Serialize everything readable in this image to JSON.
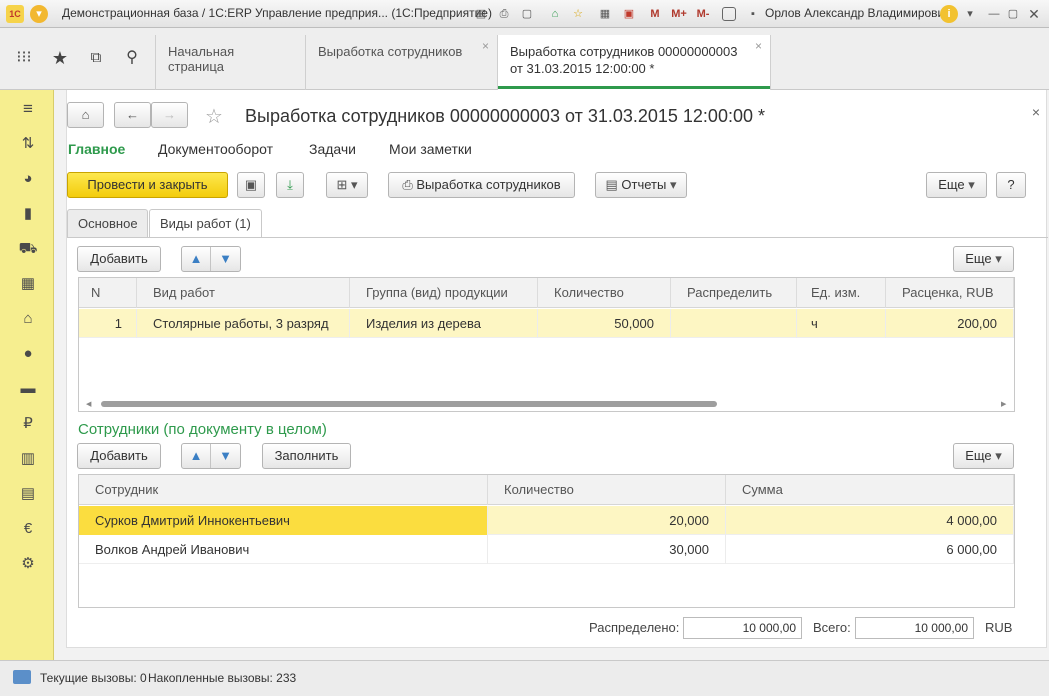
{
  "window": {
    "title": "Демонстрационная база / 1С:ERP Управление предприя... (1С:Предприятие)",
    "user": "Орлов Александр Владимирович",
    "m_labels": [
      "M",
      "M+",
      "M-"
    ]
  },
  "tabs": [
    {
      "label": "Начальная страница"
    },
    {
      "label": "Выработка сотрудников"
    },
    {
      "label_line1": "Выработка сотрудников 00000000003",
      "label_line2": "от 31.03.2015 12:00:00 *"
    }
  ],
  "form": {
    "title": "Выработка сотрудников 00000000003 от 31.03.2015 12:00:00 *",
    "nav": [
      "Главное",
      "Документооборот",
      "Задачи",
      "Мои заметки"
    ],
    "toolbar": {
      "post_close": "Провести и закрыть",
      "print_label": "Выработка сотрудников",
      "reports_label": "Отчеты",
      "more_label": "Еще",
      "help_label": "?"
    },
    "form_tabs": [
      "Основное",
      "Виды работ (1)"
    ],
    "works": {
      "add_label": "Добавить",
      "more_label": "Еще",
      "columns": [
        "N",
        "Вид работ",
        "Группа (вид) продукции",
        "Количество",
        "Распределить",
        "Ед. изм.",
        "Расценка, RUB"
      ],
      "rows": [
        {
          "n": "1",
          "work": "Столярные работы, 3 разряд",
          "group": "Изделия из дерева",
          "qty": "50,000",
          "distribute": "",
          "unit": "ч",
          "rate": "200,00"
        }
      ]
    },
    "employees": {
      "section_title": "Сотрудники (по документу в целом)",
      "add_label": "Добавить",
      "fill_label": "Заполнить",
      "more_label": "Еще",
      "columns": [
        "Сотрудник",
        "Количество",
        "Сумма"
      ],
      "rows": [
        {
          "name": "Сурков Дмитрий Иннокентьевич",
          "qty": "20,000",
          "sum": "4 000,00"
        },
        {
          "name": "Волков Андрей Иванович",
          "qty": "30,000",
          "sum": "6 000,00"
        }
      ]
    },
    "totals": {
      "distributed_label": "Распределено:",
      "distributed_value": "10 000,00",
      "total_label": "Всего:",
      "total_value": "10 000,00",
      "currency": "RUB"
    }
  },
  "status": {
    "current_calls": "Текущие вызовы: 0",
    "accumulated_calls": "Накопленные вызовы: 233"
  },
  "colors": {
    "accent_green": "#2e9a4c",
    "sidebar_yellow": "#f6ee8f",
    "primary_button": "#f3cc0c",
    "selected_row": "#fbe96b",
    "current_row": "#fdf6c3"
  }
}
